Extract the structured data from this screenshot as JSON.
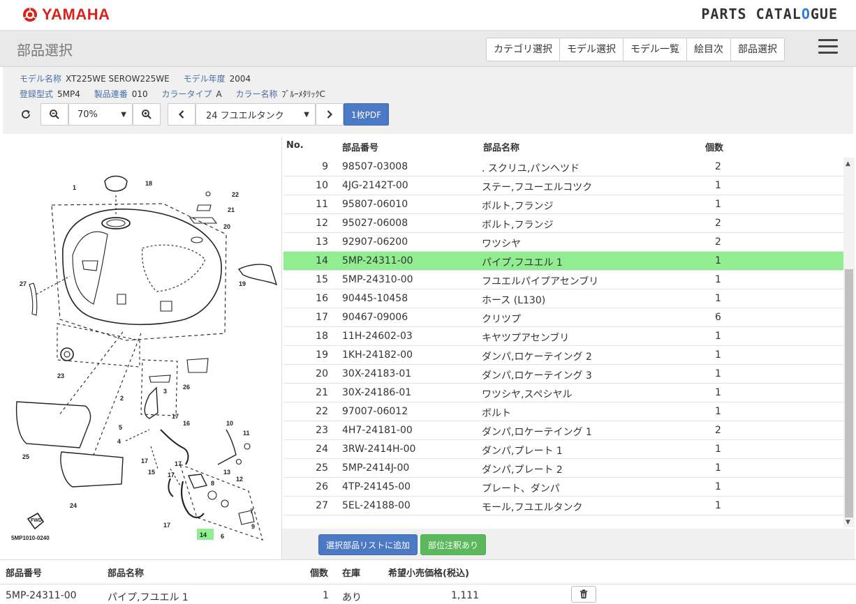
{
  "brand": {
    "logo": "YAMAHA",
    "catalogue_main": "PARTS CATAL",
    "catalogue_o": "O",
    "catalogue_end": "GUE"
  },
  "header": {
    "title": "部品選択",
    "nav": [
      "カテゴリ選択",
      "モデル選択",
      "モデル一覧",
      "絵目次",
      "部品選択"
    ]
  },
  "info": {
    "model_name_label": "モデル名称",
    "model_name": "XT225WE SEROW225WE",
    "model_year_label": "モデル年度",
    "model_year": "2004",
    "type_label": "登録型式",
    "type": "5MP4",
    "serial_label": "製品連番",
    "serial": "010",
    "color_type_label": "カラータイプ",
    "color_type": "A",
    "color_name_label": "カラー名称",
    "color_name": "ﾌﾞﾙｰﾒﾀﾘｯｸC"
  },
  "toolbar": {
    "zoom": "70%",
    "page": "24 フユエルタンク",
    "pdf": "1枚PDF"
  },
  "parts_header": {
    "no": "No.",
    "part_number": "部品番号",
    "part_name": "部品名称",
    "qty": "個数"
  },
  "parts": [
    {
      "no": "9",
      "pn": "98507-03008",
      "name": ". スクリユ,パンヘツド",
      "qty": "2"
    },
    {
      "no": "10",
      "pn": "4JG-2142T-00",
      "name": "ステー,フユーエルコツク",
      "qty": "1"
    },
    {
      "no": "11",
      "pn": "95807-06010",
      "name": "ボルト,フランジ",
      "qty": "1"
    },
    {
      "no": "12",
      "pn": "95027-06008",
      "name": "ボルト,フランジ",
      "qty": "2"
    },
    {
      "no": "13",
      "pn": "92907-06200",
      "name": "ワツシヤ",
      "qty": "2"
    },
    {
      "no": "14",
      "pn": "5MP-24311-00",
      "name": "パイプ,フユエル 1",
      "qty": "1",
      "selected": true
    },
    {
      "no": "15",
      "pn": "5MP-24310-00",
      "name": "フユエルパイプアセンブリ",
      "qty": "1"
    },
    {
      "no": "16",
      "pn": "90445-10458",
      "name": "ホース (L130)",
      "qty": "1"
    },
    {
      "no": "17",
      "pn": "90467-09006",
      "name": "クリツプ",
      "qty": "6"
    },
    {
      "no": "18",
      "pn": "11H-24602-03",
      "name": "キヤツプアセンブリ",
      "qty": "1"
    },
    {
      "no": "19",
      "pn": "1KH-24182-00",
      "name": "ダンパ,ロケーテイング 2",
      "qty": "1"
    },
    {
      "no": "20",
      "pn": "30X-24183-01",
      "name": "ダンパ,ロケーテイング 3",
      "qty": "1"
    },
    {
      "no": "21",
      "pn": "30X-24186-01",
      "name": "ワツシヤ,スペシヤル",
      "qty": "1"
    },
    {
      "no": "22",
      "pn": "97007-06012",
      "name": "ボルト",
      "qty": "1"
    },
    {
      "no": "23",
      "pn": "4H7-24181-00",
      "name": "ダンパ,ロケーテイング 1",
      "qty": "2"
    },
    {
      "no": "24",
      "pn": "3RW-2414H-00",
      "name": "ダンパ,プレート 1",
      "qty": "1"
    },
    {
      "no": "25",
      "pn": "5MP-2414J-00",
      "name": "ダンパ,プレート 2",
      "qty": "1"
    },
    {
      "no": "26",
      "pn": "4TP-24145-00",
      "name": "プレート、ダンパ",
      "qty": "1"
    },
    {
      "no": "27",
      "pn": "5EL-24188-00",
      "name": "モール,フユエルタンク",
      "qty": "1"
    }
  ],
  "actions": {
    "add_to_list": "選択部品リストに追加",
    "annotation": "部位注釈あり"
  },
  "selected_header": {
    "part_number": "部品番号",
    "part_name": "部品名称",
    "qty": "個数",
    "stock": "在庫",
    "price": "希望小売価格(税込)"
  },
  "selected_row": {
    "part_number": "5MP-24311-00",
    "part_name": "パイプ,フユエル 1",
    "qty": "1",
    "stock": "あり",
    "price": "1,111"
  },
  "diagram": {
    "code": "5MP1010-0240",
    "labels": [
      "1",
      "2",
      "3",
      "4",
      "5",
      "6",
      "7",
      "8",
      "9",
      "10",
      "11",
      "12",
      "13",
      "14",
      "15",
      "16",
      "17",
      "17",
      "17",
      "17",
      "17",
      "18",
      "19",
      "20",
      "21",
      "22",
      "23",
      "24",
      "25",
      "26",
      "27"
    ],
    "fwd": "FWD",
    "highlight": "14"
  },
  "colors": {
    "brand_red": "#d8221b",
    "selected_row": "#90ee90",
    "primary_btn": "#4b79c4",
    "success_btn": "#5cb85c"
  }
}
